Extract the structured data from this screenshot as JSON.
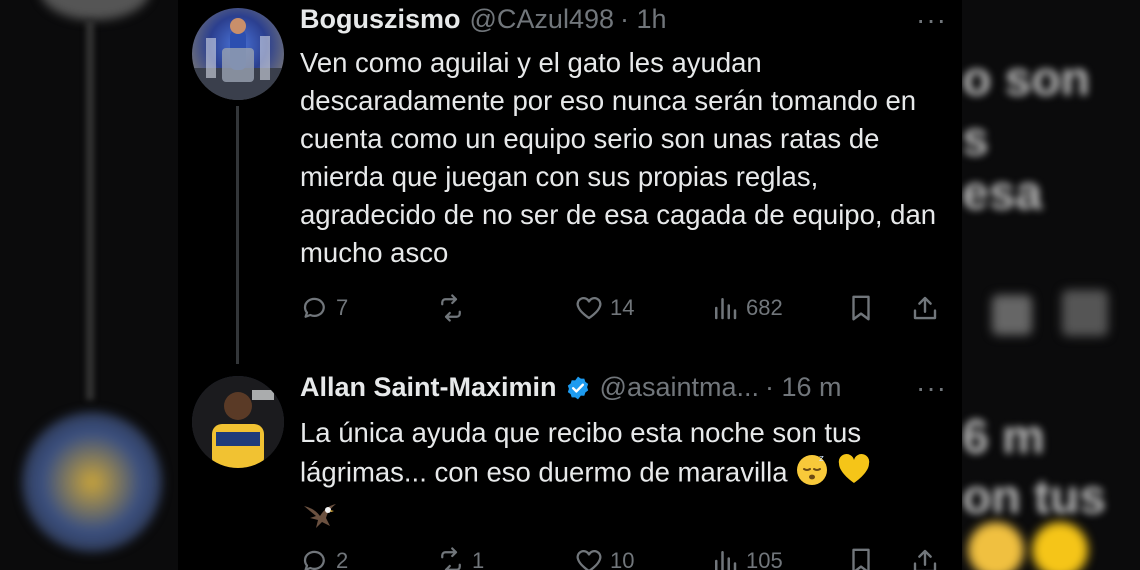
{
  "background_blur": {
    "right_lines": [
      "o son",
      "s",
      "esa",
      "6 m",
      "on tus"
    ]
  },
  "tweets": [
    {
      "name": "Boguszismo",
      "handle": "@CAzul498",
      "time": "· 1h",
      "text": "Ven como aguilai y el gato les ayudan descaradamente por eso nunca serán tomando en cuenta como un equipo serio son unas ratas de mierda que juegan con sus propias reglas, agradecido de no ser de esa cagada de equipo, dan mucho asco",
      "replies": "7",
      "reposts": "",
      "likes": "14",
      "views": "682",
      "more": "···"
    },
    {
      "name": "Allan Saint-Maximin",
      "handle": "@asaintma...",
      "time": "· 16 m",
      "verified": true,
      "text": "La única ayuda que recibo esta noche son tus lágrimas... con eso duermo de maravilla",
      "replies": "2",
      "reposts": "1",
      "likes": "10",
      "views": "105",
      "more": "···"
    }
  ],
  "icons": [
    "reply-icon",
    "repost-icon",
    "like-icon",
    "views-icon",
    "bookmark-icon",
    "share-icon",
    "verified-badge-icon",
    "sleeping-face-emoji",
    "yellow-heart-emoji",
    "eagle-emoji"
  ],
  "colors": {
    "background": "#000000",
    "text": "#e7e9ea",
    "secondary": "#71767b",
    "verified": "#1d9bf0",
    "heart": "#f5c518"
  }
}
